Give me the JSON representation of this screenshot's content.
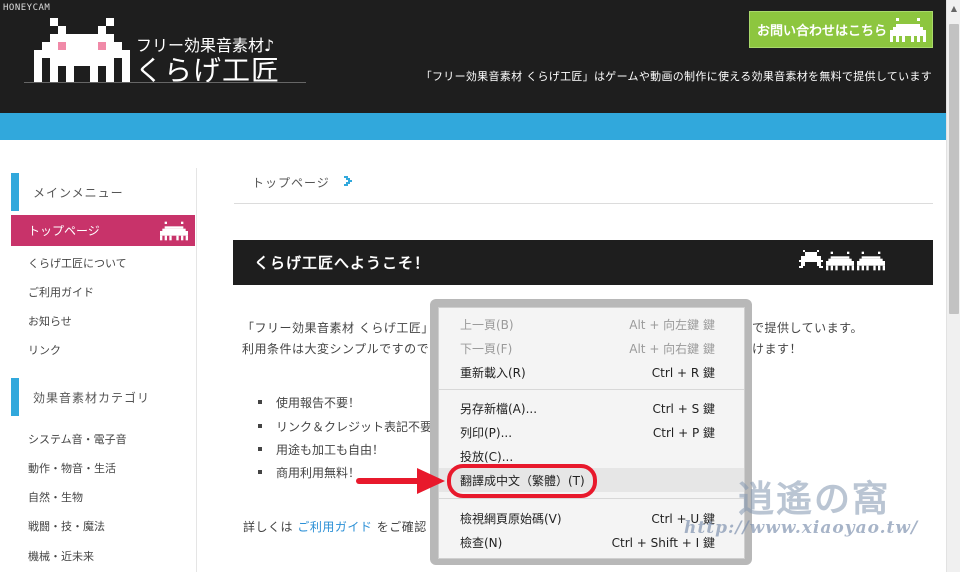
{
  "recorder_watermark": "HONEYCAM",
  "header": {
    "logo_sub": "フリー効果音素材♪",
    "logo_main": "くらげ工匠",
    "contact_button": "お問い合わせはこちら",
    "tagline": "「フリー効果音素材 くらげ工匠」はゲームや動画の制作に使える効果音素材を無料で提供しています"
  },
  "sidebar": {
    "main_menu_heading": "メインメニュー",
    "main_items": [
      {
        "label": "トップページ",
        "active": true
      },
      {
        "label": "くらげ工匠について"
      },
      {
        "label": "ご利用ガイド"
      },
      {
        "label": "お知らせ"
      },
      {
        "label": "リンク"
      }
    ],
    "category_heading": "効果音素材カテゴリ",
    "category_items": [
      {
        "label": "システム音・電子音"
      },
      {
        "label": "動作・物音・生活"
      },
      {
        "label": "自然・生物"
      },
      {
        "label": "戦闘・技・魔法"
      },
      {
        "label": "機械・近未来"
      }
    ]
  },
  "main": {
    "breadcrumb": "トップページ",
    "welcome_title": "くらげ工匠へようこそ！",
    "intro_line1_start": "「フリー効果音素材 くらげ工匠」",
    "intro_line1_end": "で提供しています。",
    "intro_line2_start": "利用条件は大変シンプルですので",
    "intro_line2_end": "けます！",
    "bullets": [
      "使用報告不要！",
      "リンク＆クレジット表記不要",
      "用途も加工も自由！",
      "商用利用無料！"
    ],
    "details_prefix": "詳しくは",
    "details_link": "ご利用ガイド",
    "details_suffix": "をご確認"
  },
  "context_menu": {
    "items": [
      {
        "label": "上一頁(B)",
        "shortcut": "Alt + 向左鍵 鍵",
        "disabled": true
      },
      {
        "label": "下一頁(F)",
        "shortcut": "Alt + 向右鍵 鍵",
        "disabled": true
      },
      {
        "label": "重新載入(R)",
        "shortcut": "Ctrl + R 鍵"
      },
      {
        "label": "另存新檔(A)...",
        "shortcut": "Ctrl + S 鍵"
      },
      {
        "label": "列印(P)...",
        "shortcut": "Ctrl + P 鍵"
      },
      {
        "label": "投放(C)...",
        "shortcut": ""
      },
      {
        "label": "翻譯成中文（繁體）(T)",
        "shortcut": "",
        "highlighted": true
      },
      {
        "label": "檢視網頁原始碼(V)",
        "shortcut": "Ctrl + U 鍵"
      },
      {
        "label": "檢查(N)",
        "shortcut": "Ctrl + Shift + I 鍵"
      }
    ]
  },
  "watermark": {
    "brand": "逍遙の窩",
    "url": "http://www.xiaoyao.tw/"
  },
  "colors": {
    "header_bg": "#1e1e1e",
    "accent_blue": "#31a8dc",
    "active_pink": "#c8336a",
    "contact_green": "#8dc63f",
    "annotation_red": "#e8192c"
  }
}
